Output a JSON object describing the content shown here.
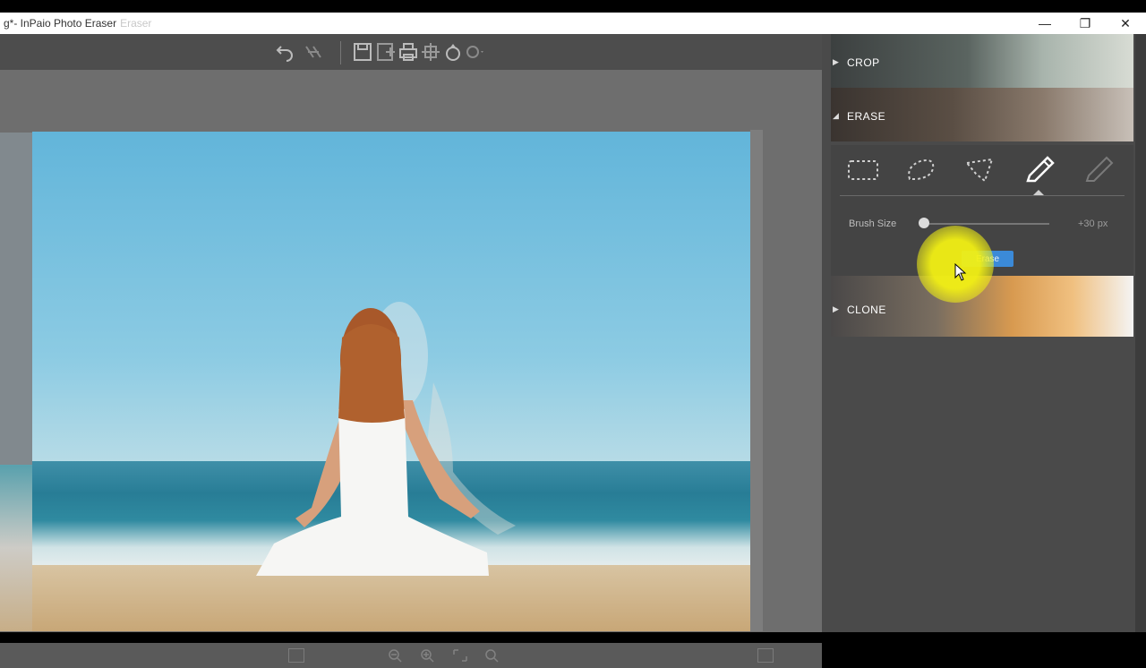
{
  "window": {
    "title_prefix": "g*- InPaio Photo Eraser",
    "title_suffix": "Eraser",
    "min_symbol": "—",
    "max_symbol": "❐",
    "close_symbol": "✕"
  },
  "toolbar": {
    "icons": [
      "undo-icon",
      "redo-icon",
      "save-icon",
      "save-as-icon",
      "print-icon",
      "move-icon",
      "share-icon",
      "dropdown-icon"
    ]
  },
  "panel": {
    "crop_label": "CROP",
    "erase_label": "ERASE",
    "clone_label": "CLONE",
    "brush_size_label": "Brush Size",
    "brush_size_value": "+30 px",
    "brush_size_level": 0.0,
    "apply_label": "Erase",
    "tools": [
      "rectangle-select-icon",
      "lasso-select-icon",
      "polygon-lasso-icon",
      "pencil-icon",
      "eraser-pencil-icon"
    ],
    "active_tool": "pencil-icon"
  },
  "colors": {
    "panel_bg": "#4a4a4a",
    "canvas_bg": "#6e6e6e",
    "accent": "#3b8ad8",
    "cursor_highlight": "#f2f014"
  }
}
